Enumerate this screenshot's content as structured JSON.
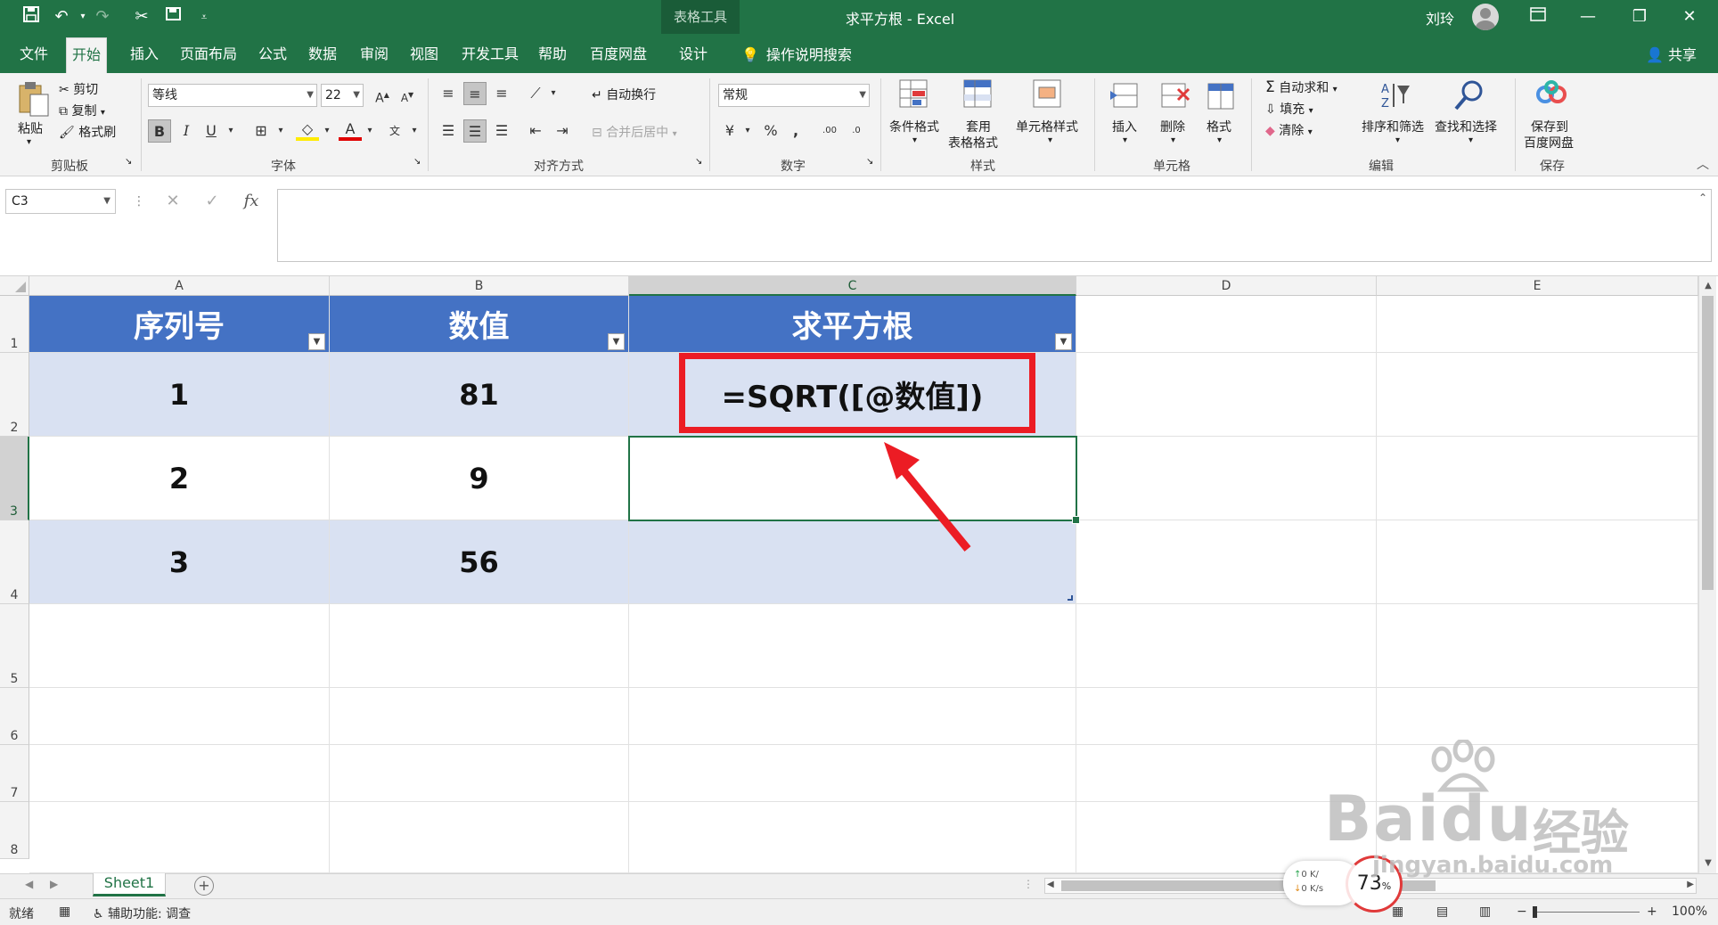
{
  "app": {
    "title": "求平方根 - Excel",
    "context_group": "表格工具",
    "user": "刘玲",
    "share": "共享",
    "tell_me": "操作说明搜索"
  },
  "tabs": [
    "文件",
    "开始",
    "插入",
    "页面布局",
    "公式",
    "数据",
    "审阅",
    "视图",
    "开发工具",
    "帮助",
    "百度网盘",
    "设计"
  ],
  "ribbon": {
    "clipboard": {
      "label": "剪贴板",
      "paste": "粘贴",
      "cut": "剪切",
      "copy": "复制",
      "format_painter": "格式刷"
    },
    "font": {
      "label": "字体",
      "font_name": "等线",
      "font_size": "22"
    },
    "alignment": {
      "label": "对齐方式",
      "wrap": "自动换行",
      "merge": "合并后居中"
    },
    "number": {
      "label": "数字",
      "format": "常规"
    },
    "styles": {
      "label": "样式",
      "conditional": "条件格式",
      "table_a": "套用",
      "table_b": "表格格式",
      "cell_styles": "单元格样式"
    },
    "cells": {
      "label": "单元格",
      "insert": "插入",
      "delete": "删除",
      "format": "格式"
    },
    "editing": {
      "label": "编辑",
      "autosum": "自动求和",
      "fill": "填充",
      "clear": "清除",
      "sort": "排序和筛选",
      "find": "查找和选择"
    },
    "save": {
      "label": "保存",
      "line1": "保存到",
      "line2": "百度网盘"
    }
  },
  "formula_bar": {
    "name_box": "C3",
    "fx": "fx",
    "content": ""
  },
  "grid": {
    "columns": [
      "A",
      "B",
      "C",
      "D",
      "E"
    ],
    "rows": [
      "1",
      "2",
      "3",
      "4",
      "5",
      "6",
      "7",
      "8"
    ],
    "selected_col": "C",
    "selected_row": "3",
    "headers": [
      "序列号",
      "数值",
      "求平方根"
    ],
    "data": [
      [
        "1",
        "81",
        "=SQRT([@数值])"
      ],
      [
        "2",
        "9",
        ""
      ],
      [
        "3",
        "56",
        ""
      ]
    ]
  },
  "sheet": {
    "name": "Sheet1"
  },
  "status": {
    "ready": "就绪",
    "accessibility": "辅助功能: 调查",
    "zoom": "100%"
  },
  "overlay": {
    "net_up": "0",
    "net_down": "0",
    "net_unit_up": "K/",
    "net_unit_down": "K/s",
    "percent": "73",
    "percent_sign": "%",
    "watermark_brand": "Baidu",
    "watermark_cn": "经验",
    "watermark_url": "jingyan.baidu.com"
  },
  "colors": {
    "excel_green": "#217346",
    "table_header": "#4472c4",
    "table_band": "#d9e1f2",
    "highlight": "#ec1c24"
  }
}
